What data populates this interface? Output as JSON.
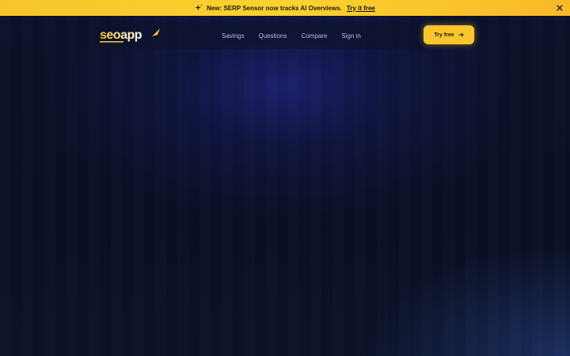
{
  "banner": {
    "message": "New: SERP Sensor now tracks AI Overviews.",
    "link": "Try it free",
    "sparkle_icon": "sparkle-icon",
    "close_icon": "close-icon",
    "background": "#fdd22f"
  },
  "nav": {
    "logo_text": "seoapp",
    "links": [
      "Savings",
      "Questions",
      "Compare",
      "Sign in"
    ],
    "cta_label": "Try free",
    "cta_icon": "arrow-right-icon",
    "accent": "#fbc62d"
  }
}
